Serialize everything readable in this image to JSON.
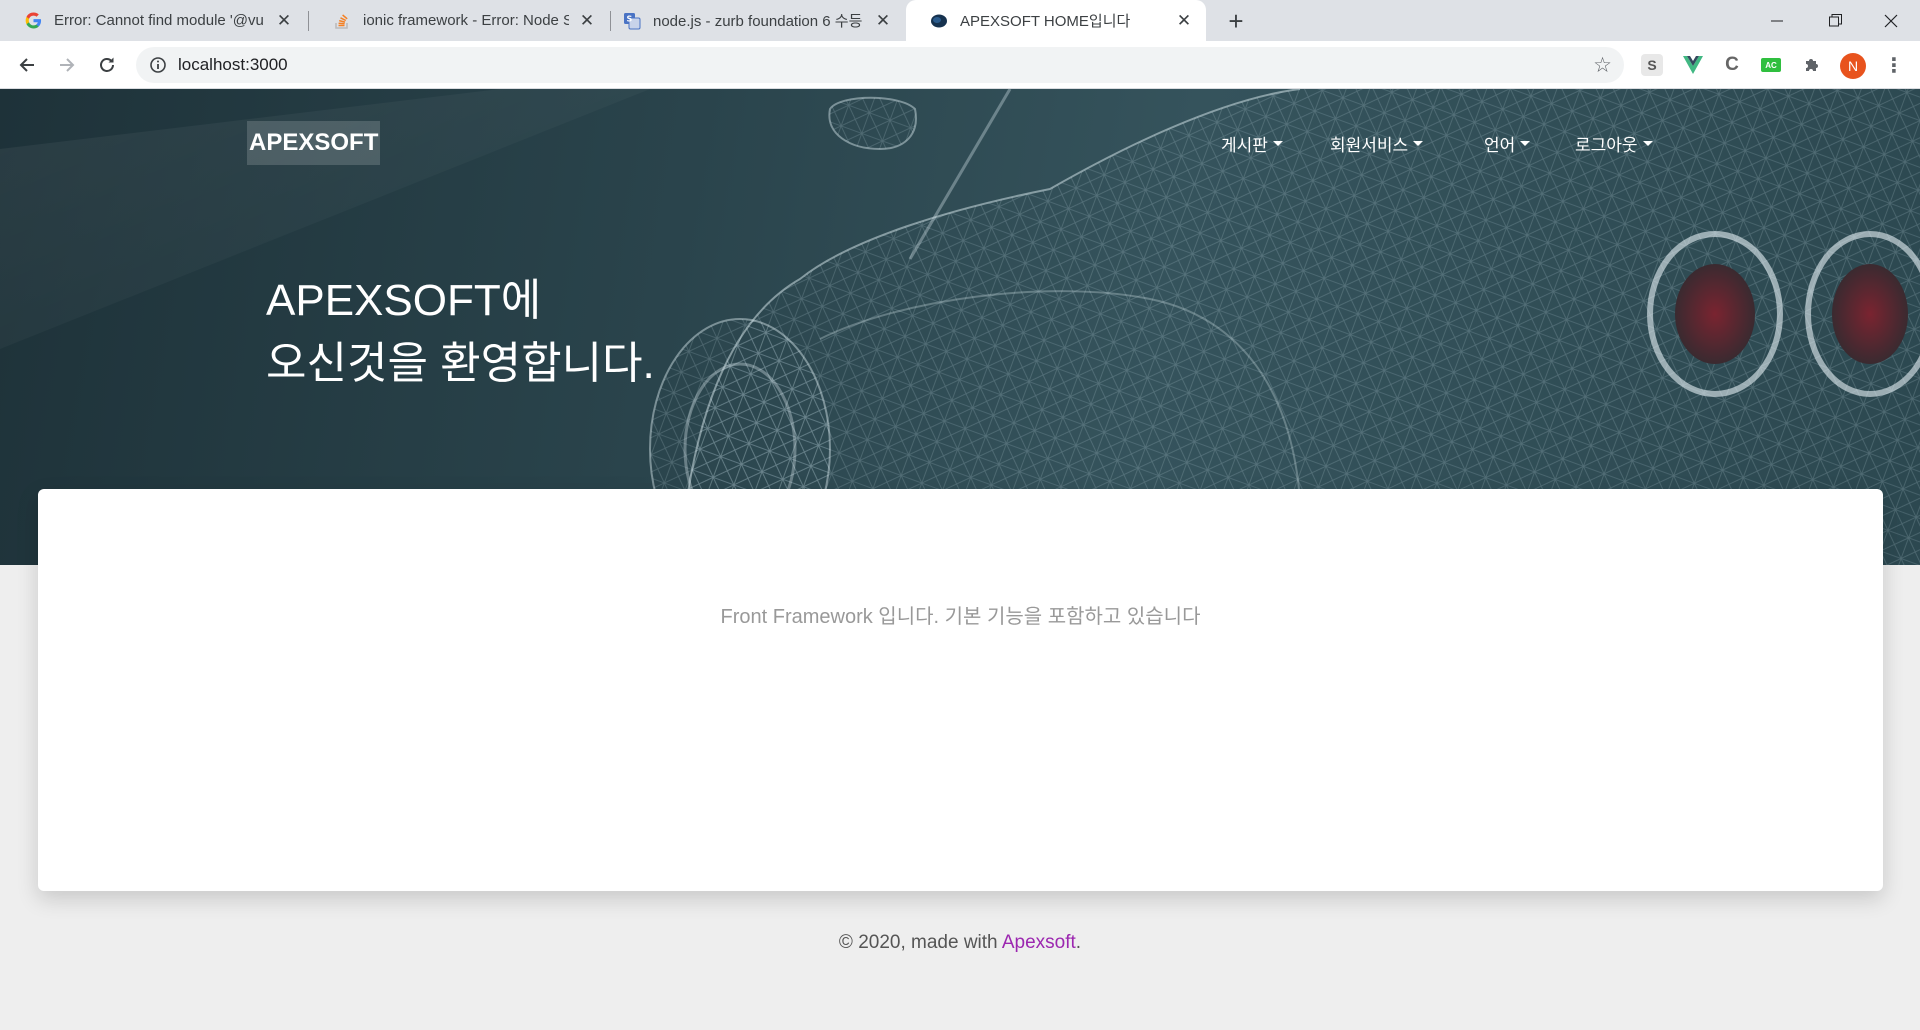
{
  "browser": {
    "tabs": [
      {
        "title": "Error: Cannot find module '@vu",
        "favicon": "google-icon",
        "active": false
      },
      {
        "title": "ionic framework - Error: Node S",
        "favicon": "stackoverflow-icon",
        "active": false
      },
      {
        "title": "node.js - zurb foundation 6 수등",
        "favicon": "translate-icon",
        "active": false
      },
      {
        "title": "APEXSOFT HOME입니다",
        "favicon": "apexsoft-icon",
        "active": true
      }
    ],
    "new_tab_label": "+",
    "url": "localhost:3000",
    "profile_initial": "N",
    "extensions": [
      "S",
      "V",
      "C",
      "AC",
      "puzzle-icon"
    ]
  },
  "site": {
    "brand": "APEXSOFT",
    "nav": [
      {
        "label": "게시판"
      },
      {
        "label": "회원서비스"
      },
      {
        "label": "언어"
      },
      {
        "label": "로그아웃"
      }
    ],
    "headline_line1": "APEXSOFT에",
    "headline_line2": "오신것을 환영합니다.",
    "card_text": "Front Framework 입니다. 기본 기능을 포함하고 있습니다",
    "footer_prefix": "© 2020, made with ",
    "footer_link": "Apexsoft",
    "footer_suffix": "."
  },
  "colors": {
    "hero_dark": "#1e3239",
    "link": "#9c27b0",
    "profile": "#e8531d"
  }
}
